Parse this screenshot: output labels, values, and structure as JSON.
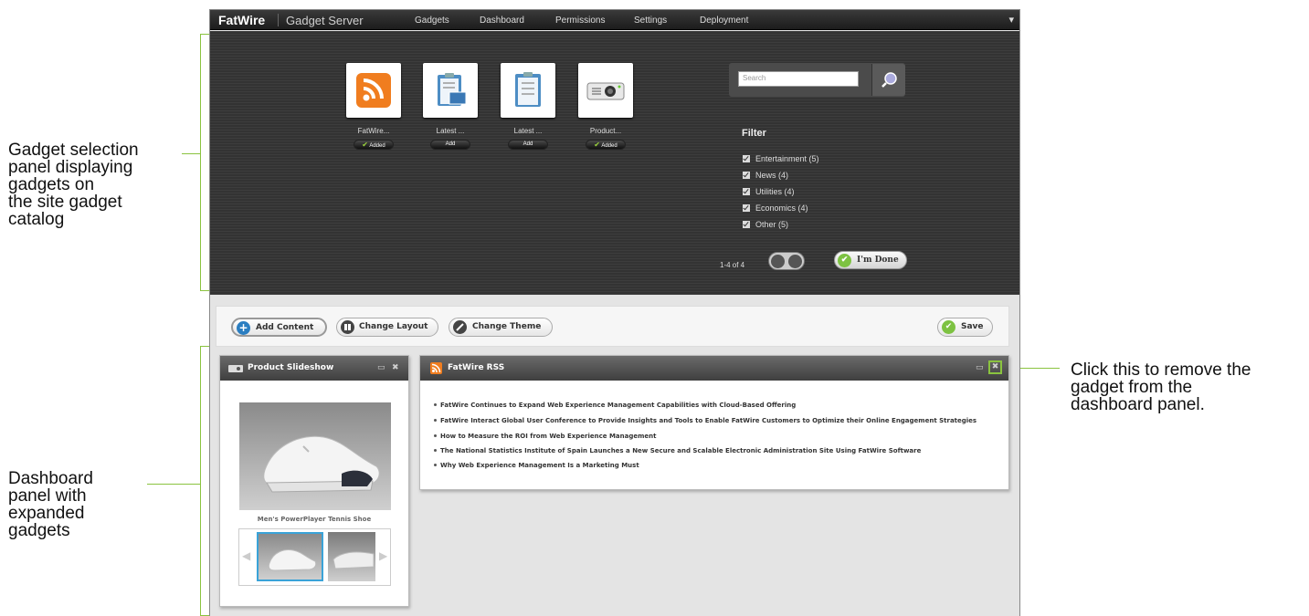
{
  "annotations": {
    "gadget_selection": "Gadget selection\npanel displaying\ngadgets on\nthe site gadget\ncatalog",
    "dashboard_panel": "Dashboard\npanel with\nexpanded\ngadgets",
    "remove_hint": "Click this to remove the\ngadget from the\ndashboard panel."
  },
  "header": {
    "brand": "FatWire",
    "app_name": "Gadget Server",
    "nav": [
      "Gadgets",
      "Dashboard",
      "Permissions",
      "Settings",
      "Deployment"
    ],
    "collapse_icon": "chevron-down-icon"
  },
  "catalog": {
    "gadgets": [
      {
        "name": "FatWire...",
        "status": "Added",
        "icon": "rss-icon"
      },
      {
        "name": "Latest ...",
        "status": "Add",
        "icon": "clipboard-image-icon"
      },
      {
        "name": "Latest ...",
        "status": "Add",
        "icon": "clipboard-icon"
      },
      {
        "name": "Product...",
        "status": "Added",
        "icon": "projector-icon"
      }
    ],
    "search_placeholder": "Search",
    "filter_title": "Filter",
    "filters": [
      "Entertainment (5)",
      "News (4)",
      "Utilities (4)",
      "Economics (4)",
      "Other (5)"
    ],
    "pager": "1-4 of 4",
    "done_label": "I'm Done"
  },
  "toolbar": {
    "add_content": "Add Content",
    "change_layout": "Change Layout",
    "change_theme": "Change Theme",
    "save": "Save"
  },
  "slideshow": {
    "title": "Product Slideshow",
    "caption": "Men's PowerPlayer Tennis Shoe"
  },
  "rss": {
    "title": "FatWire RSS",
    "items": [
      "FatWire Continues to Expand Web Experience Management Capabilities with Cloud-Based Offering",
      "FatWire Interact Global User Conference to Provide Insights and Tools to Enable FatWire Customers to Optimize their Online Engagement Strategies",
      "How to Measure the ROI from Web Experience Management",
      "The National Statistics Institute of Spain Launches a New Secure and Scalable Electronic Administration Site Using FatWire Software",
      "Why Web Experience Management Is a Marketing Must"
    ]
  },
  "colors": {
    "accent_green": "#8ac33f",
    "header_dark": "#1c1c1c",
    "panel_dark": "#363636"
  }
}
